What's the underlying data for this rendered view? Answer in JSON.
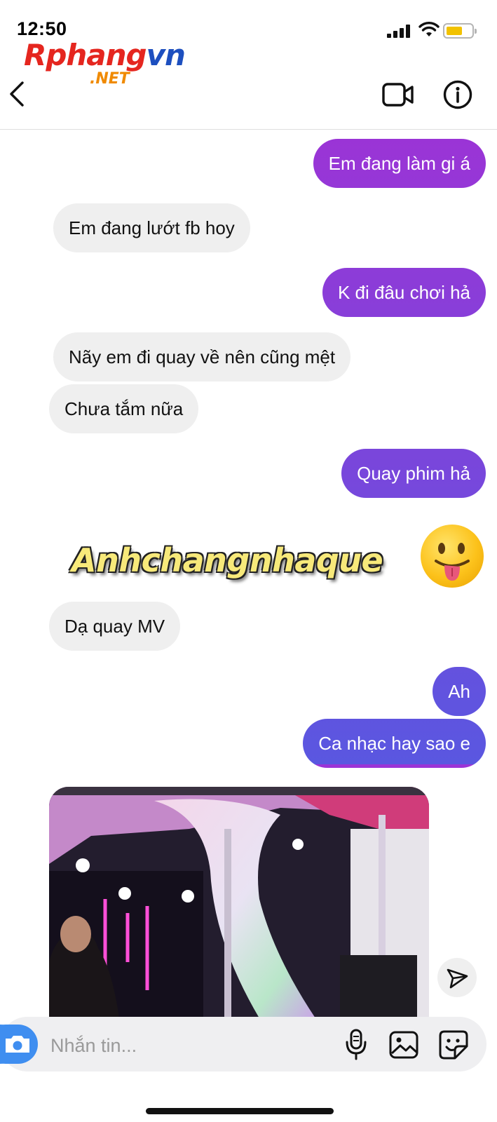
{
  "status_bar": {
    "time": "12:50",
    "battery_color": "#f2c200"
  },
  "watermark": {
    "brand_r": "R",
    "brand_mid": "phang",
    "brand_vn": "vn",
    "brand_net": ".NET"
  },
  "header": {
    "back_icon": "chevron-left-icon",
    "video_icon": "video-camera-icon",
    "info_icon": "info-icon"
  },
  "colors": {
    "outgoing_top": "#9b34d6",
    "outgoing_bottom": "#5a57e0",
    "incoming": "#efefef"
  },
  "messages": [
    {
      "dir": "out",
      "text": "Em đang làm gi á"
    },
    {
      "dir": "in",
      "text": "Em đang lướt fb hoy"
    },
    {
      "dir": "out",
      "text": "K đi đâu chơi hả"
    },
    {
      "dir": "in",
      "text": "Nãy em đi quay về nên cũng mệt"
    },
    {
      "dir": "in",
      "text": "Chưa tắm nữa"
    },
    {
      "dir": "out",
      "text": "Quay phim hả"
    },
    {
      "dir": "in",
      "text": "Dạ quay MV"
    },
    {
      "dir": "out",
      "text": "Ah"
    },
    {
      "dir": "out",
      "text": "Ca nhạc hay sao e"
    }
  ],
  "sticker_text": "Anhchangnhaque",
  "composer": {
    "placeholder": "Nhắn tin..."
  }
}
